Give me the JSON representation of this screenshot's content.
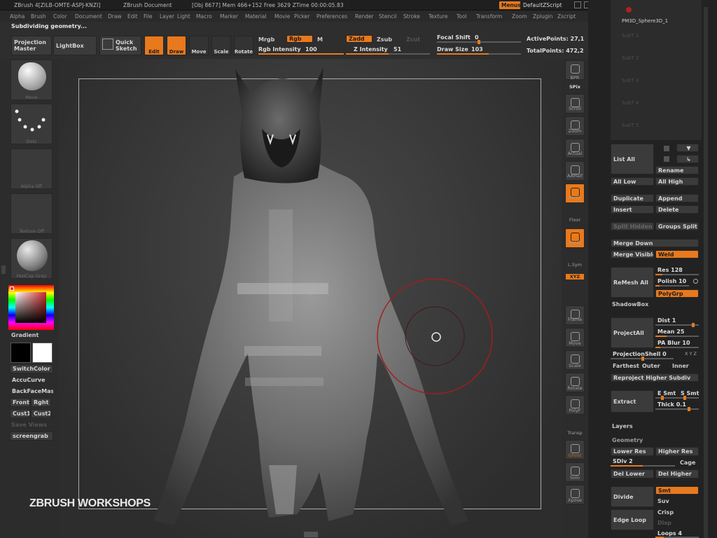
{
  "titlebar": {
    "app": "ZBrush 4[ZILB-OMTE-ASPJ-KNZI]",
    "document": "ZBrush Document",
    "stats": "[Obj 8677] Mem 466+152 Free 3629 ZTime 00:00:05.83",
    "menus_label": "Menus",
    "zscript_label": "DefaultZScript"
  },
  "menubar": [
    "Alpha",
    "Brush",
    "Color",
    "Document",
    "Draw",
    "Edit",
    "File",
    "Layer",
    "Light",
    "Macro",
    "Marker",
    "Material",
    "Movie",
    "Picker",
    "Preferences",
    "Render",
    "Stencil",
    "Stroke",
    "Texture",
    "Tool",
    "Transform",
    "Zoom",
    "Zplugin",
    "Zscript"
  ],
  "status": "Subdividing geometry...",
  "toolbar": {
    "projection_master": "Projection Master",
    "lightbox": "LightBox",
    "quick_sketch": "Quick Sketch",
    "edit": "Edit",
    "draw": "Draw",
    "move": "Move",
    "scale": "Scale",
    "rotate": "Rotate",
    "mrgb": "Mrgb",
    "rgb": "Rgb",
    "m": "M",
    "rgb_intensity_label": "Rgb Intensity",
    "rgb_intensity": "100",
    "zadd": "Zadd",
    "zsub": "Zsub",
    "zcut": "Zcut",
    "z_intensity_label": "Z Intensity",
    "z_intensity": "51",
    "focal_shift_label": "Focal Shift",
    "focal_shift": "0",
    "draw_size_label": "Draw Size",
    "draw_size": "103",
    "active_points": "ActivePoints: 27,1",
    "total_points": "TotalPoints: 472,2"
  },
  "leftshelf": {
    "brush": "Move",
    "stroke": "Dots",
    "alpha": "Alpha Off",
    "texture": "Texture Off",
    "material": "MatCap Gray",
    "gradient": "Gradient",
    "switchcolor": "SwitchColor",
    "accucurve": "AccuCurve",
    "backface": "BackFaceMas",
    "front": "Front",
    "right": "Rght",
    "cust1": "Cust1",
    "cust2": "Cust2",
    "saveviews": "Save Views",
    "screengrab": "screengrab"
  },
  "rightshelf": [
    "BPR",
    "SPix",
    "Scroll",
    "Zoom",
    "Actual",
    "AAHalf",
    "Persp",
    "Floor",
    "Local",
    "L.Sym",
    "XYZ",
    "Frame",
    "Move",
    "Scale",
    "Rotate",
    "PolyF",
    "Transp",
    "Ghost",
    "Solo",
    "Xpose"
  ],
  "watermark": "ZBRUSH WORKSHOPS",
  "tray": {
    "subtools": [
      "PM3D_Sphere3D_1",
      "SubT 1",
      "SubT 2",
      "SubT 3",
      "SubT 4",
      "SubT 5"
    ],
    "list_all": "List All",
    "rename": "Rename",
    "all_low": "All Low",
    "all_high": "All High",
    "duplicate": "Duplicate",
    "append": "Append",
    "insert": "Insert",
    "delete": "Delete",
    "split_hidden": "Split Hidden",
    "groups_split": "Groups Split",
    "merge_down": "Merge Down",
    "merge_visible": "Merge Visible",
    "weld": "Weld",
    "remesh_all": "ReMesh All",
    "res": "Res 128",
    "polish": "Polish 10",
    "polygrp": "PolyGrp",
    "shadowbox": "ShadowBox",
    "projectall": "ProjectAll",
    "dist": "Dist 1",
    "mean": "Mean 25",
    "pa_blur": "PA Blur 10",
    "projectionshell": "ProjectionShell 0",
    "xyz_small": "X Y Z",
    "farthest": "Farthest",
    "outer": "Outer",
    "inner": "Inner",
    "reproject": "Reproject Higher Subdiv",
    "extract": "Extract",
    "esmt": "E Smt",
    "s_smt": "S Smt",
    "thick": "Thick 0.1",
    "layers": "Layers",
    "geometry": "Geometry",
    "lower_res": "Lower Res",
    "higher_res": "Higher Res",
    "sdiv": "SDiv 2",
    "cage": "Cage",
    "del_lower": "Del Lower",
    "del_higher": "Del Higher",
    "divide": "Divide",
    "smt": "Smt",
    "suv": "Suv",
    "crisp": "Crisp",
    "edge_loop": "Edge Loop",
    "loops": "Loops 4",
    "disp": "Disp"
  }
}
